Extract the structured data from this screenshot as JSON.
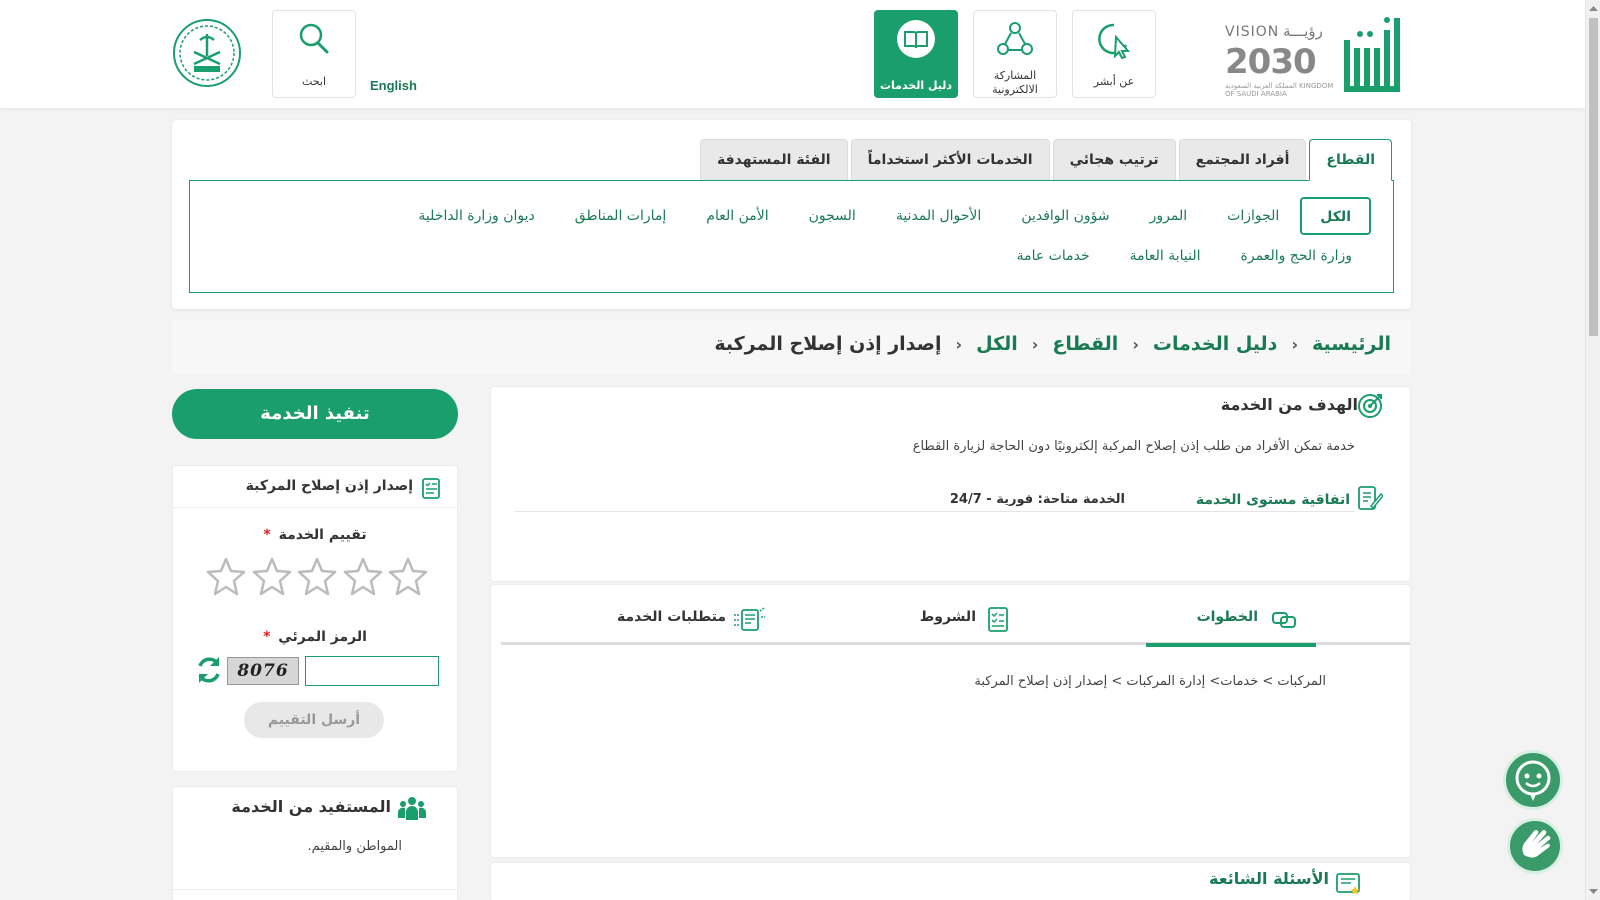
{
  "header": {
    "logo_absher_text": "أبشر",
    "vision": {
      "word": "VISION",
      "year": "2030",
      "arabic": "رؤيـــة",
      "sub": "المملكة العربية السعودية KINGDOM OF SAUDI ARABIA"
    },
    "buttons": [
      {
        "label": "عن أبشر",
        "icon": "touch-icon"
      },
      {
        "label": "المشاركة الالكترونية",
        "icon": "share-network-icon"
      },
      {
        "label": "دليل الخدمات",
        "icon": "book-icon",
        "active": true
      },
      {
        "label": "ابحث",
        "icon": "search-icon"
      }
    ],
    "language_link": "English",
    "emblem_icon": "saudi-emblem-icon"
  },
  "sector": {
    "tabs": [
      "القطاع",
      "أفراد المجتمع",
      "ترتيب هجائي",
      "الخدمات الأكثر استخداماً",
      "الفئة المستهدفة"
    ],
    "active_tab": "القطاع",
    "chips": [
      "الكل",
      "الجوازات",
      "المرور",
      "شؤون الوافدين",
      "الأحوال المدنية",
      "السجون",
      "الأمن العام",
      "إمارات المناطق",
      "ديوان وزارة الداخلية",
      "وزارة الحج والعمرة",
      "النيابة العامة",
      "خدمات عامة"
    ],
    "active_chip": "الكل"
  },
  "breadcrumb": [
    "الرئيسية",
    "دليل الخدمات",
    "القطاع",
    "الكل",
    "إصدار إذن إصلاح المركبة"
  ],
  "goal": {
    "title": "الهدف من الخدمة",
    "description": "خدمة تمكن الأفراد من طلب إذن إصلاح المركبة إلكترونيًا دون الحاجة لزيارة القطاع",
    "sla_label": "اتفاقية مستوى الخدمة",
    "sla_value": "الخدمة متاحة: فورية - 24/7"
  },
  "steps": {
    "tabs": [
      "الخطوات",
      "الشروط",
      "متطلبات الخدمة"
    ],
    "active_tab": "الخطوات",
    "content": "المركبات > خدمات> إدارة المركبات > إصدار إذن إصلاح المركبة"
  },
  "faq": {
    "title": "الأسئلة الشائعة"
  },
  "actions": {
    "execute_label": "تنفيذ الخدمة"
  },
  "rating": {
    "title": "إصدار إذن إصلاح المركبة",
    "rating_label": "تقييم الخدمة",
    "required_mark": "*",
    "stars_total": 5,
    "stars_selected": 0,
    "captcha_label": "الرمز المرئي",
    "captcha_text": "8076",
    "captcha_value": "",
    "send_label": "أرسل التقييم"
  },
  "beneficiary": {
    "title": "المستفيد من الخدمة",
    "description": "المواطن والمقيم."
  },
  "floating": {
    "chat_icon": "chatbot-icon",
    "sign_icon": "sign-language-icon"
  },
  "colors": {
    "primary": "#1a9e6d",
    "primary_dark": "#1a7a55",
    "background": "#f3f3f3"
  }
}
